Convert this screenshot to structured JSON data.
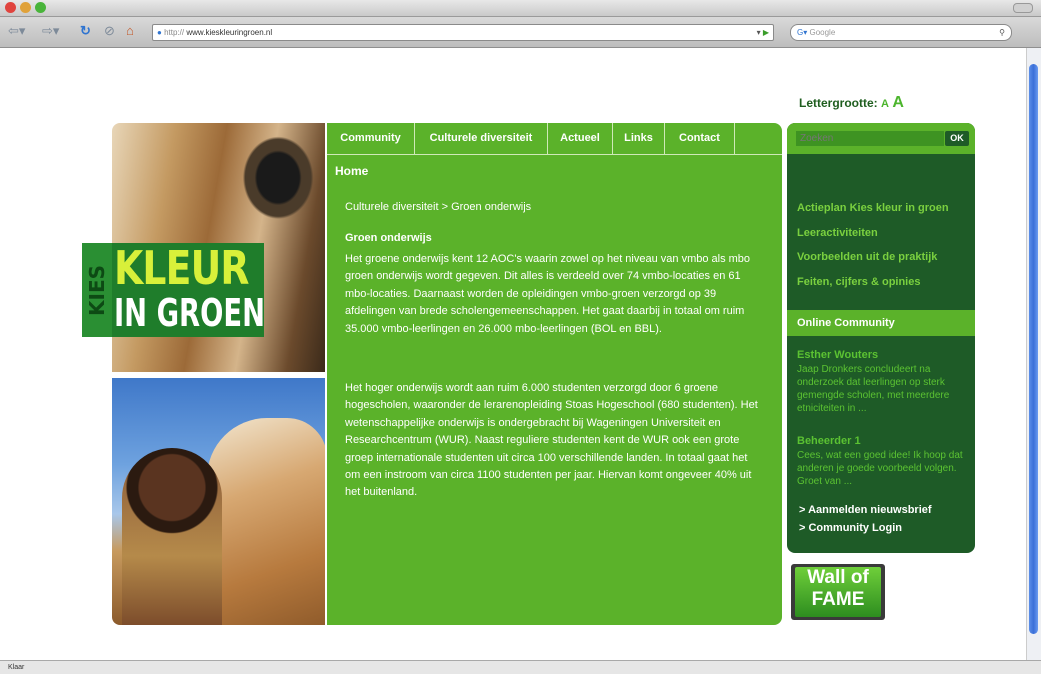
{
  "browser": {
    "url_prefix": "http://",
    "url": "www.kieskleuringroen.nl",
    "search_placeholder": "Google",
    "status_text": "Klaar"
  },
  "page": {
    "letter_size_label": "Lettergrootte:",
    "letter_small": "A",
    "letter_large": "A",
    "logo": {
      "kies": "KIES",
      "kleur": "KLEUR",
      "in_groen": "IN GROEN"
    },
    "nav": [
      "Community",
      "Culturele diversiteit",
      "Actueel",
      "Links",
      "Contact"
    ],
    "home": "Home",
    "breadcrumb": "Culturele diversiteit > Groen onderwijs",
    "heading": "Groen onderwijs",
    "paragraph1": "Het groene onderwijs kent 12 AOC's waarin zowel op het niveau van vmbo als mbo groen onderwijs wordt gegeven. Dit alles is verdeeld over 74 vmbo-locaties en 61 mbo-locaties. Daarnaast worden de opleidingen vmbo-groen verzorgd op 39 afdelingen van brede scholengemeenschappen. Het gaat daarbij in totaal om ruim 35.000 vmbo-leerlingen en 26.000 mbo-leerlingen (BOL en BBL).",
    "paragraph2": "Het hoger onderwijs wordt aan ruim 6.000 studenten verzorgd door 6 groene hogescholen, waaronder de lerarenopleiding Stoas Hogeschool (680 studenten). Het wetenschappelijke onderwijs is ondergebracht bij Wageningen Universiteit en Researchcentrum (WUR). Naast reguliere studenten kent de WUR ook een grote groep internationale studenten uit circa 100 verschillende landen. In totaal gaat het om een instroom van circa 1100 studenten per jaar. Hiervan komt ongeveer 40% uit het buitenland."
  },
  "sidebar": {
    "search_placeholder": "Zoeken",
    "ok": "OK",
    "links": [
      "Actieplan Kies kleur in groen",
      "Leeractiviteiten",
      "Voorbeelden uit de praktijk",
      "Feiten, cijfers & opinies"
    ],
    "community_title": "Online Community",
    "posts": [
      {
        "name": "Esther Wouters",
        "text": "Jaap Dronkers concludeert na onderzoek dat leerlingen op sterk gemengde scholen, met meerdere etniciteiten in ..."
      },
      {
        "name": "Beheerder 1",
        "text": "Cees, wat een goed idee! Ik hoop dat anderen je goede voorbeeld volgen. Groet van ..."
      }
    ],
    "bottom_links": [
      "> Aanmelden nieuwsbrief",
      "> Community Login"
    ]
  },
  "wall": {
    "line1": "Wall of",
    "line2": "FAME"
  }
}
